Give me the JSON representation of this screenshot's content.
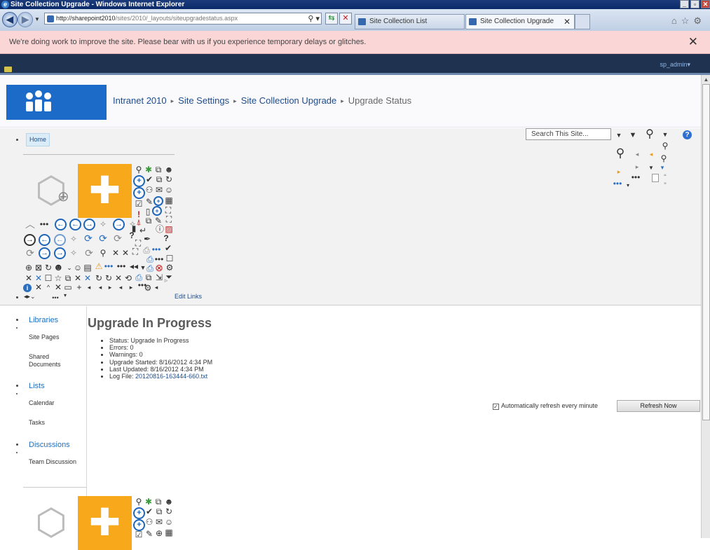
{
  "window": {
    "title": "Site Collection Upgrade - Windows Internet Explorer",
    "controls": [
      "_",
      "▫",
      "✕"
    ]
  },
  "browser": {
    "url_host": "http://sharepoint2010",
    "url_path": "/sites/2010/_layouts/siteupgradestatus.aspx",
    "tabs": [
      {
        "label": "Site Collection List",
        "active": false
      },
      {
        "label": "Site Collection Upgrade",
        "active": true
      }
    ],
    "tab_close": "✕"
  },
  "notification": {
    "message": "We're doing work to improve the site. Please bear with us if you experience temporary delays or glitches.",
    "close": "✕"
  },
  "ribbon": {
    "user": "sp_admin"
  },
  "breadcrumb": {
    "items": [
      "Intranet 2010",
      "Site Settings",
      "Site Collection Upgrade"
    ],
    "current": "Upgrade Status",
    "separator": "▸"
  },
  "topnav": {
    "home": "Home",
    "search_placeholder": "Search This Site...",
    "help": "?",
    "edit_links": "Edit Links"
  },
  "leftnav": {
    "sections": [
      {
        "heading": "Libraries",
        "items": [
          "Site Pages",
          "Shared Documents"
        ]
      },
      {
        "heading": "Lists",
        "items": [
          "Calendar",
          "Tasks"
        ]
      },
      {
        "heading": "Discussions",
        "items": [
          "Team Discussion"
        ]
      }
    ]
  },
  "main": {
    "heading": "Upgrade In Progress",
    "status": [
      "Status: Upgrade In Progress",
      "Errors: 0",
      "Warnings: 0",
      "Upgrade Started: 8/16/2012 4:34 PM",
      "Last Updated: 8/16/2012 4:34 PM"
    ],
    "log_label": "Log File:",
    "log_file": "20120816-163444-660.txt",
    "auto_refresh_label": "Automatically refresh every minute",
    "auto_refresh_checked": true,
    "refresh_button": "Refresh Now"
  },
  "colors": {
    "accent": "#1c6bc8",
    "ribbon": "#1f3350",
    "notice_bg": "#fad6d6",
    "puzzle": "#f7a81b",
    "link": "#1d4c8c"
  }
}
